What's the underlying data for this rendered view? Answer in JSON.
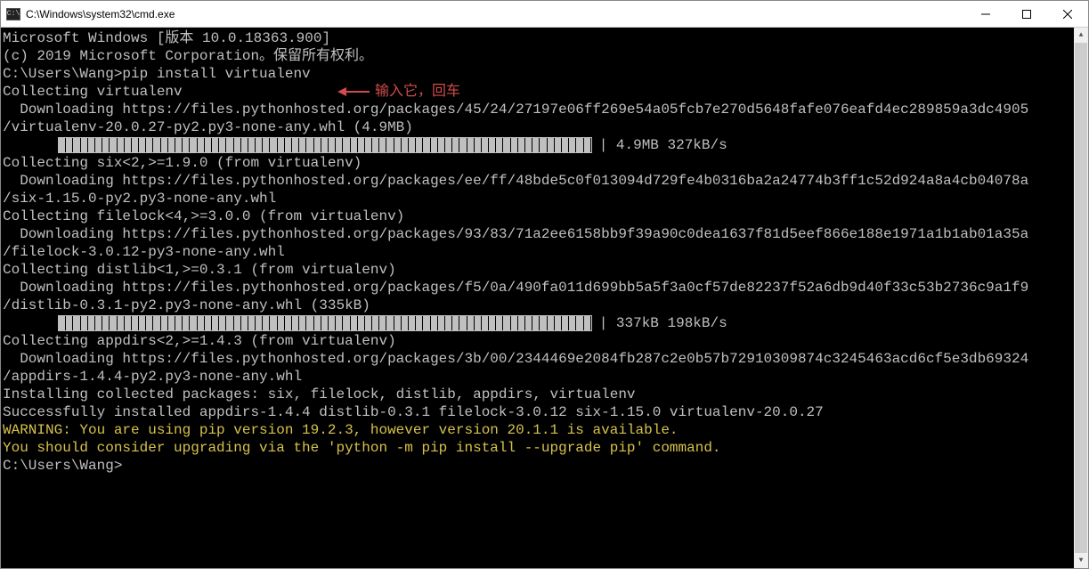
{
  "window": {
    "title": "C:\\Windows\\system32\\cmd.exe",
    "icon_name": "cmd-icon"
  },
  "annotation": {
    "text": "输入它，回车",
    "color": "#d14c4c"
  },
  "terminal": {
    "lines": [
      {
        "cls": "gray",
        "text": "Microsoft Windows [版本 10.0.18363.900]"
      },
      {
        "cls": "gray",
        "text": "(c) 2019 Microsoft Corporation。保留所有权利。"
      },
      {
        "cls": "gray",
        "text": ""
      },
      {
        "cls": "gray",
        "text": "C:\\Users\\Wang>pip install virtualenv"
      },
      {
        "cls": "gray",
        "text": "Collecting virtualenv"
      },
      {
        "cls": "gray",
        "text": "  Downloading https://files.pythonhosted.org/packages/45/24/27197e06ff269e54a05fcb7e270d5648fafe076eafd4ec289859a3dc4905"
      },
      {
        "cls": "gray",
        "text": "/virtualenv-20.0.27-py2.py3-none-any.whl (4.9MB)"
      },
      {
        "type": "bar",
        "filled": 73,
        "empty": 0,
        "label": "| 4.9MB 327kB/s"
      },
      {
        "cls": "gray",
        "text": "Collecting six<2,>=1.9.0 (from virtualenv)"
      },
      {
        "cls": "gray",
        "text": "  Downloading https://files.pythonhosted.org/packages/ee/ff/48bde5c0f013094d729fe4b0316ba2a24774b3ff1c52d924a8a4cb04078a"
      },
      {
        "cls": "gray",
        "text": "/six-1.15.0-py2.py3-none-any.whl"
      },
      {
        "cls": "gray",
        "text": "Collecting filelock<4,>=3.0.0 (from virtualenv)"
      },
      {
        "cls": "gray",
        "text": "  Downloading https://files.pythonhosted.org/packages/93/83/71a2ee6158bb9f39a90c0dea1637f81d5eef866e188e1971a1b1ab01a35a"
      },
      {
        "cls": "gray",
        "text": "/filelock-3.0.12-py3-none-any.whl"
      },
      {
        "cls": "gray",
        "text": "Collecting distlib<1,>=0.3.1 (from virtualenv)"
      },
      {
        "cls": "gray",
        "text": "  Downloading https://files.pythonhosted.org/packages/f5/0a/490fa011d699bb5a5f3a0cf57de82237f52a6db9d40f33c53b2736c9a1f9"
      },
      {
        "cls": "gray",
        "text": "/distlib-0.3.1-py2.py3-none-any.whl (335kB)"
      },
      {
        "type": "bar",
        "filled": 73,
        "empty": 0,
        "label": "| 337kB 198kB/s"
      },
      {
        "cls": "gray",
        "text": "Collecting appdirs<2,>=1.4.3 (from virtualenv)"
      },
      {
        "cls": "gray",
        "text": "  Downloading https://files.pythonhosted.org/packages/3b/00/2344469e2084fb287c2e0b57b72910309874c3245463acd6cf5e3db69324"
      },
      {
        "cls": "gray",
        "text": "/appdirs-1.4.4-py2.py3-none-any.whl"
      },
      {
        "cls": "gray",
        "text": "Installing collected packages: six, filelock, distlib, appdirs, virtualenv"
      },
      {
        "cls": "gray",
        "text": "Successfully installed appdirs-1.4.4 distlib-0.3.1 filelock-3.0.12 six-1.15.0 virtualenv-20.0.27"
      },
      {
        "cls": "yellow",
        "text": "WARNING: You are using pip version 19.2.3, however version 20.1.1 is available."
      },
      {
        "cls": "yellow",
        "text": "You should consider upgrading via the 'python -m pip install --upgrade pip' command."
      },
      {
        "cls": "gray",
        "text": ""
      },
      {
        "cls": "gray",
        "text": "C:\\Users\\Wang>"
      }
    ]
  },
  "winControls": {
    "min": "—",
    "max": "☐",
    "close": "✕"
  }
}
